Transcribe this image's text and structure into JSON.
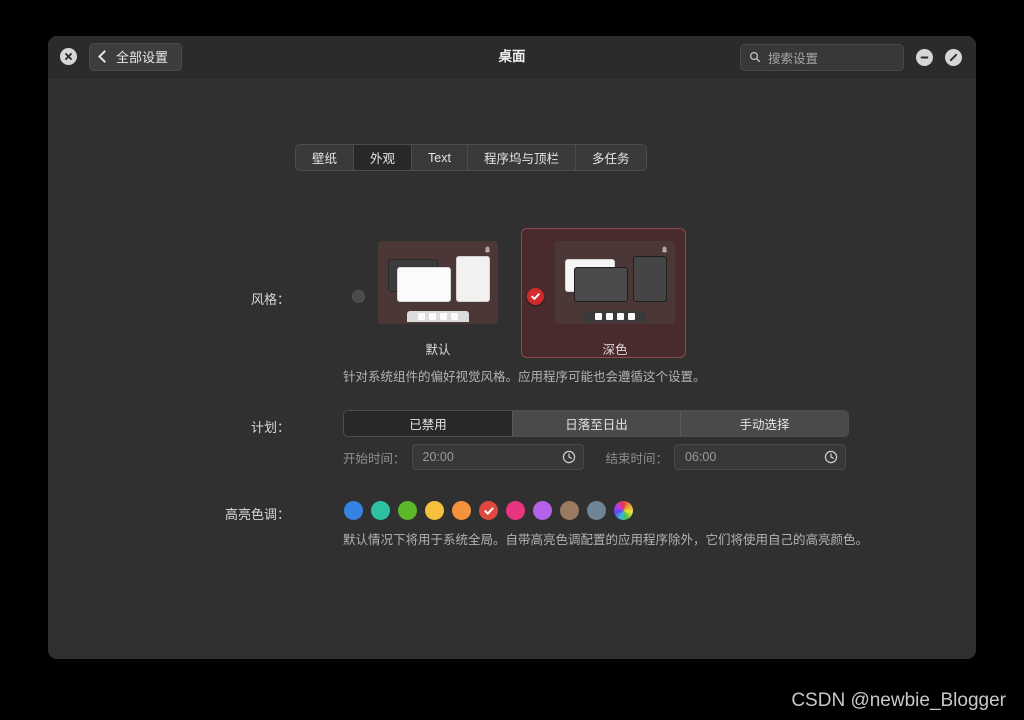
{
  "window": {
    "title": "桌面",
    "close_icon": "close-circle-icon",
    "minimize_icon": "minimize-circle-icon",
    "window_close_icon": "close-slash-circle-icon",
    "back_label": "全部设置",
    "back_icon": "chevron-left-icon"
  },
  "search": {
    "placeholder": "搜索设置",
    "icon": "search-icon"
  },
  "tabs": [
    {
      "label": "壁纸",
      "active": false
    },
    {
      "label": "外观",
      "active": true
    },
    {
      "label": "Text",
      "active": false
    },
    {
      "label": "程序坞与顶栏",
      "active": false
    },
    {
      "label": "多任务",
      "active": false
    }
  ],
  "style_section": {
    "label": "风格：",
    "helper": "针对系统组件的偏好视觉风格。应用程序可能也会遵循这个设置。",
    "options": [
      {
        "caption": "默认",
        "selected": false,
        "radio_icon": "radio-unchecked-icon"
      },
      {
        "caption": "深色",
        "selected": true,
        "radio_icon": "check-circle-icon"
      }
    ],
    "selected_color": "#d02c2c"
  },
  "schedule_section": {
    "label": "计划：",
    "segments": [
      {
        "label": "已禁用",
        "active": true
      },
      {
        "label": "日落至日出",
        "active": false
      },
      {
        "label": "手动选择",
        "active": false
      }
    ],
    "start": {
      "label": "开始时间：",
      "value": "20:00",
      "icon": "clock-icon"
    },
    "end": {
      "label": "结束时间：",
      "value": "06:00",
      "icon": "clock-icon"
    }
  },
  "accent_section": {
    "label": "高亮色调：",
    "helper": "默认情况下将用于系统全局。自带高亮色调配置的应用程序除外，它们将使用自己的高亮颜色。",
    "swatches": [
      {
        "name": "blue",
        "color": "#3584e4",
        "selected": false
      },
      {
        "name": "teal",
        "color": "#2ec0a0",
        "selected": false
      },
      {
        "name": "green",
        "color": "#5cb82a",
        "selected": false
      },
      {
        "name": "yellow",
        "color": "#f5c13d",
        "selected": false
      },
      {
        "name": "orange",
        "color": "#f5933d",
        "selected": false
      },
      {
        "name": "red",
        "color": "#e0473f",
        "selected": true
      },
      {
        "name": "pink",
        "color": "#e8357f",
        "selected": false
      },
      {
        "name": "purple",
        "color": "#b463e8",
        "selected": false
      },
      {
        "name": "brown",
        "color": "#9b7b60",
        "selected": false
      },
      {
        "name": "slate",
        "color": "#6f8494",
        "selected": false
      },
      {
        "name": "custom",
        "color": "rainbow",
        "selected": false
      }
    ],
    "check_icon": "check-icon"
  },
  "watermark": {
    "text": "CSDN @newbie_Blogger"
  }
}
